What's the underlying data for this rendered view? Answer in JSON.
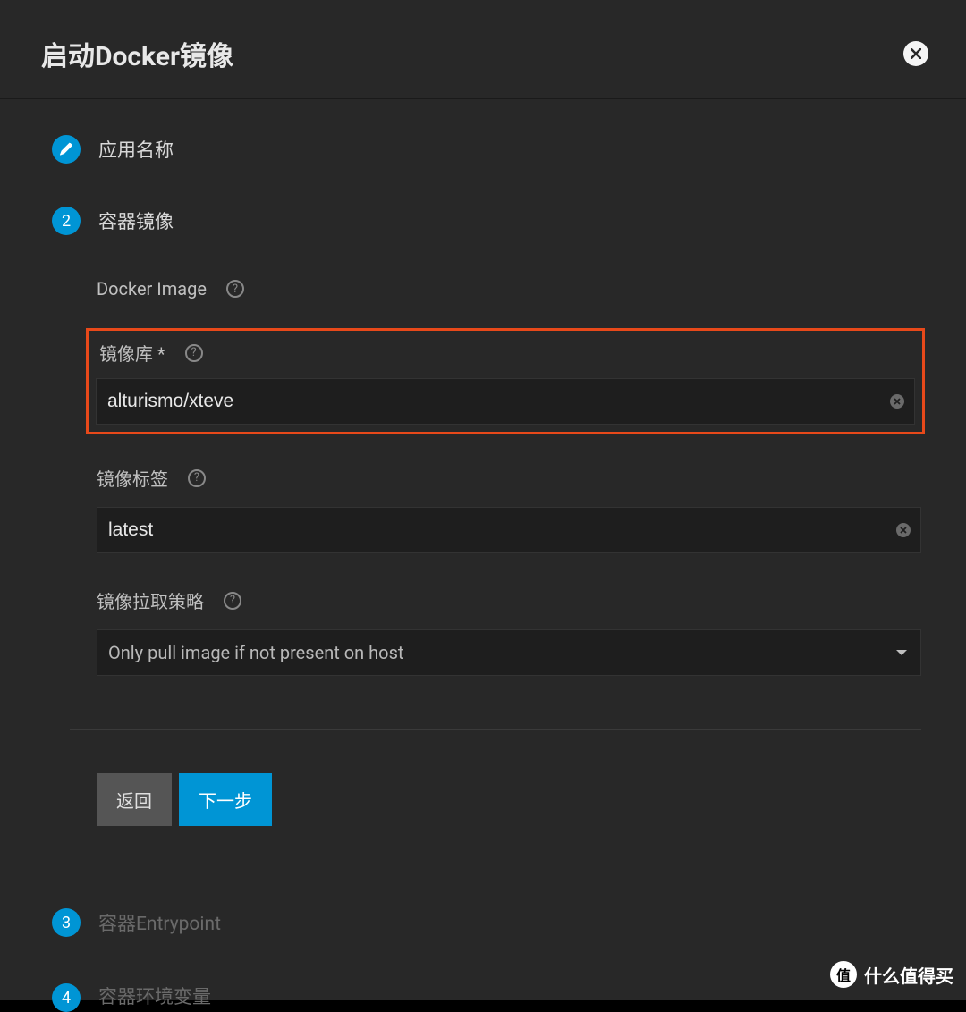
{
  "dialog": {
    "title": "启动Docker镜像"
  },
  "steps": {
    "s1": {
      "label": "应用名称"
    },
    "s2": {
      "num": "2",
      "label": "容器镜像"
    },
    "s3": {
      "num": "3",
      "label": "容器Entrypoint"
    },
    "s4": {
      "num": "4",
      "label": "容器环境变量"
    }
  },
  "fields": {
    "dockerImage": {
      "label": "Docker Image"
    },
    "repository": {
      "label": "镜像库 *",
      "value": "alturismo/xteve"
    },
    "tag": {
      "label": "镜像标签",
      "value": "latest"
    },
    "pullPolicy": {
      "label": "镜像拉取策略",
      "value": "Only pull image if not present on host"
    }
  },
  "buttons": {
    "back": "返回",
    "next": "下一步"
  },
  "watermark": {
    "badge": "值",
    "text": "什么值得买"
  }
}
